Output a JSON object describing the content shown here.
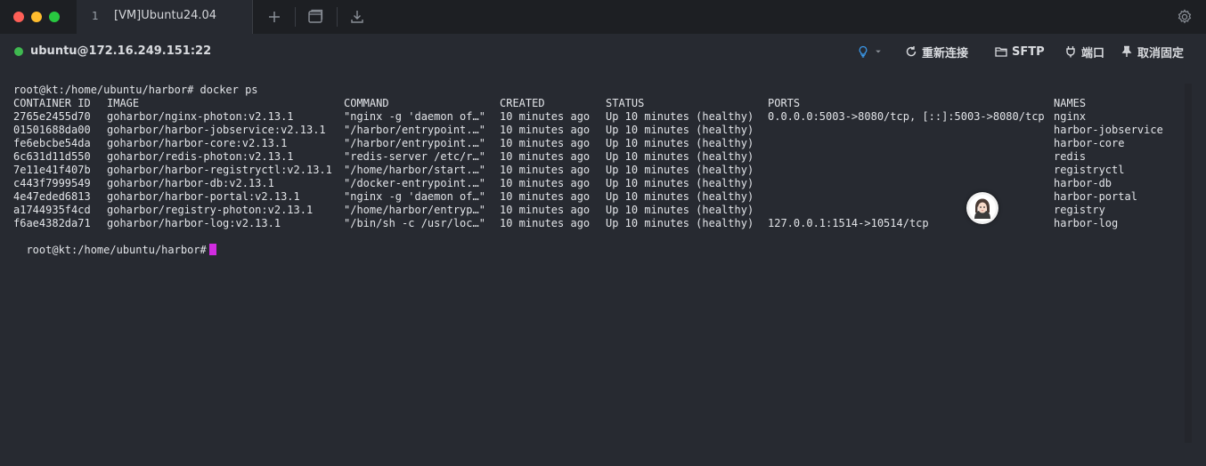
{
  "window": {
    "tab": {
      "number": "1",
      "title": "[VM]Ubuntu24.04"
    }
  },
  "connection": {
    "host": "ubuntu@172.16.249.151:22",
    "status_color": "#3fb950"
  },
  "actions": {
    "reconnect": "重新连接",
    "sftp": "SFTP",
    "port": "端口",
    "unpin": "取消固定"
  },
  "terminal": {
    "prompt_line": "root@kt:/home/ubuntu/harbor# docker ps",
    "final_prompt": "root@kt:/home/ubuntu/harbor#",
    "cursor_color": "#d12ce0",
    "headers": [
      "CONTAINER ID",
      "IMAGE",
      "COMMAND",
      "CREATED",
      "STATUS",
      "PORTS",
      "NAMES"
    ],
    "rows": [
      [
        "2765e2455d70",
        "goharbor/nginx-photon:v2.13.1",
        "\"nginx -g 'daemon of…\"",
        "10 minutes ago",
        "Up 10 minutes (healthy)",
        "0.0.0.0:5003->8080/tcp, [::]:5003->8080/tcp",
        "nginx"
      ],
      [
        "01501688da00",
        "goharbor/harbor-jobservice:v2.13.1",
        "\"/harbor/entrypoint.…\"",
        "10 minutes ago",
        "Up 10 minutes (healthy)",
        "",
        "harbor-jobservice"
      ],
      [
        "fe6ebcbe54da",
        "goharbor/harbor-core:v2.13.1",
        "\"/harbor/entrypoint.…\"",
        "10 minutes ago",
        "Up 10 minutes (healthy)",
        "",
        "harbor-core"
      ],
      [
        "6c631d11d550",
        "goharbor/redis-photon:v2.13.1",
        "\"redis-server /etc/r…\"",
        "10 minutes ago",
        "Up 10 minutes (healthy)",
        "",
        "redis"
      ],
      [
        "7e11e41f407b",
        "goharbor/harbor-registryctl:v2.13.1",
        "\"/home/harbor/start.…\"",
        "10 minutes ago",
        "Up 10 minutes (healthy)",
        "",
        "registryctl"
      ],
      [
        "c443f7999549",
        "goharbor/harbor-db:v2.13.1",
        "\"/docker-entrypoint.…\"",
        "10 minutes ago",
        "Up 10 minutes (healthy)",
        "",
        "harbor-db"
      ],
      [
        "4e47eded6813",
        "goharbor/harbor-portal:v2.13.1",
        "\"nginx -g 'daemon of…\"",
        "10 minutes ago",
        "Up 10 minutes (healthy)",
        "",
        "harbor-portal"
      ],
      [
        "a1744935f4cd",
        "goharbor/registry-photon:v2.13.1",
        "\"/home/harbor/entryp…\"",
        "10 minutes ago",
        "Up 10 minutes (healthy)",
        "",
        "registry"
      ],
      [
        "f6ae4382da71",
        "goharbor/harbor-log:v2.13.1",
        "\"/bin/sh -c /usr/loc…\"",
        "10 minutes ago",
        "Up 10 minutes (healthy)",
        "127.0.0.1:1514->10514/tcp",
        "harbor-log"
      ]
    ]
  }
}
